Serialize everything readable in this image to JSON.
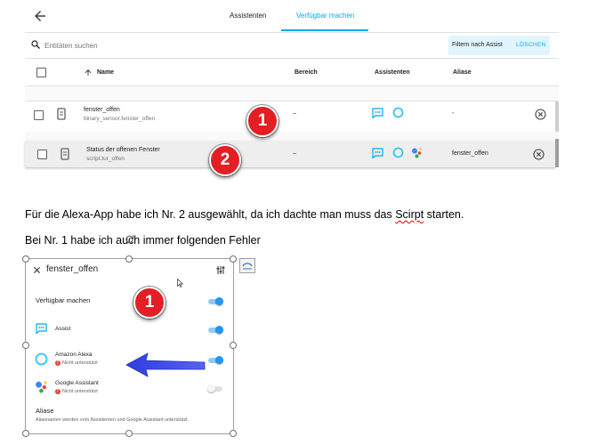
{
  "tabs": {
    "assistants": "Assistenten",
    "expose": "Verfügbar machen"
  },
  "search": {
    "placeholder": "Entitäten suchen"
  },
  "filter": {
    "label": "Filtern nach Assist",
    "clear": "LÖSCHEN"
  },
  "table": {
    "headers": {
      "name": "Name",
      "area": "Bereich",
      "assistants": "Assistenten",
      "aliases": "Aliase"
    },
    "rows": [
      {
        "name": "fenster_offen",
        "entity_id": "binary_sensor.fenster_offen",
        "area": "–",
        "aliases": "-"
      },
      {
        "name": "Status der offenen Fenster",
        "entity_id": "script.tur_offen",
        "area": "–",
        "aliases": "fenster_offen"
      }
    ]
  },
  "markers": {
    "one": "1",
    "two": "2"
  },
  "document": {
    "line1_pre": "Für die Alexa-App habe ich Nr. 2 ausgewählt, da ich dachte man muss das ",
    "line1_word": "Scirpt",
    "line1_post": " starten.",
    "line2": "Bei Nr. 1 habe ich auch immer folgenden Fehler"
  },
  "dialog": {
    "title": "fenster_offen",
    "expose_label": "Verfügbar machen",
    "assist_label": "Assist",
    "alexa_label": "Amazon Alexa",
    "alexa_error": "Nicht unterstützt",
    "google_label": "Google Assistant",
    "google_error": "Nicht unterstützt",
    "aliases_title": "Aliase",
    "aliases_hint": "Aliasnamen werden vom Assistenten und Google Assistant unterstützt."
  },
  "toggles": {
    "expose": true,
    "assist": true,
    "alexa": true,
    "google": false
  },
  "colors": {
    "accent": "#03a9f4",
    "badge_red": "#e31e24",
    "arrow_blue": "#3a48e8",
    "error_red": "#db4437"
  },
  "icons": [
    "back-arrow-icon",
    "search-icon",
    "sort-arrow-up-icon",
    "sensor-icon",
    "script-icon",
    "assist-chat-icon",
    "alexa-ring-icon",
    "google-assistant-icon",
    "remove-circle-icon",
    "close-icon",
    "tune-icon",
    "rotate-handle-icon",
    "layout-options-icon"
  ]
}
